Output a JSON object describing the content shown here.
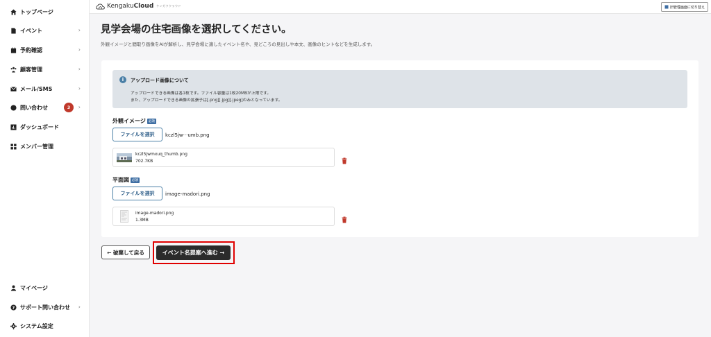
{
  "sidebar": {
    "items": [
      {
        "label": "トップページ",
        "icon": "home-icon",
        "chevron": ""
      },
      {
        "label": "イベント",
        "icon": "document-icon",
        "chevron": "›"
      },
      {
        "label": "予約確認",
        "icon": "calendar-icon",
        "chevron": "›"
      },
      {
        "label": "顧客管理",
        "icon": "people-icon",
        "chevron": "›"
      },
      {
        "label": "メール/SMS",
        "icon": "mail-icon",
        "chevron": "›"
      },
      {
        "label": "問い合わせ",
        "icon": "chat-icon",
        "chevron": "›",
        "badge": "3"
      },
      {
        "label": "ダッシュボード",
        "icon": "chart-icon",
        "chevron": ""
      },
      {
        "label": "メンバー管理",
        "icon": "grid-icon",
        "chevron": ""
      }
    ],
    "bottom_items": [
      {
        "label": "マイページ",
        "icon": "user-icon",
        "chevron": ""
      },
      {
        "label": "サポート問い合わせ",
        "icon": "help-icon",
        "chevron": "›"
      },
      {
        "label": "システム設定",
        "icon": "gear-icon",
        "chevron": ""
      }
    ]
  },
  "header": {
    "logo_text_prefix": "Kengaku",
    "logo_text_bold": "Cloud",
    "logo_sub": "ケンガククラウド",
    "switch_button": "旧管理画面に切り替え"
  },
  "main": {
    "title": "見学会場の住宅画像を選択してください。",
    "description": "外観イメージと間取り画像をAIが解析し、見学会場に適したイベント名や、見どころの見出しや本文、画像のヒントなどを生成します。",
    "info": {
      "title": "アップロード画像について",
      "line1": "アップロードできる画像は各1枚です。ファイル容量は1枚20MBが上限です。",
      "line2": "また、アップロードできる画像の拡張子は[.png][.jpg][.jpeg]のみとなっています。"
    },
    "exterior": {
      "label": "外観イメージ",
      "required": "必須",
      "button": "ファイルを選択",
      "selected": "kczl5jw···umb.png",
      "file_name": "kczl5jwmxuq_thumb.png",
      "file_size": "702.7KB"
    },
    "floorplan": {
      "label": "平面図",
      "required": "必須",
      "button": "ファイルを選択",
      "selected": "image-madori.png",
      "file_name": "image-madori.png",
      "file_size": "1.3MB"
    },
    "back_button": "← 破棄して戻る",
    "next_button": "イベント名提案へ進む →"
  },
  "colors": {
    "accent": "#4a7fa6",
    "danger": "#c0392b",
    "highlight": "#e00000"
  }
}
